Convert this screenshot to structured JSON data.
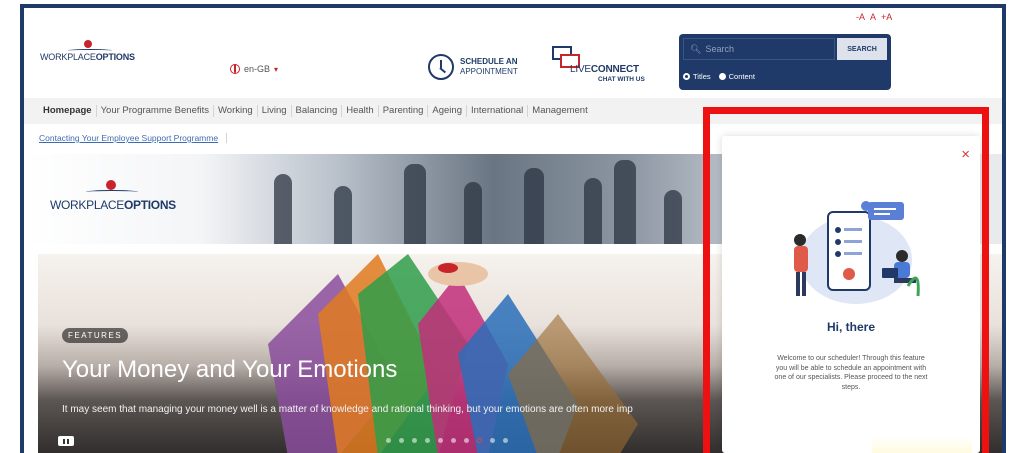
{
  "header": {
    "logo_prefix": "WORKPLACE",
    "logo_suffix": "OPTIONS",
    "language": "en-GB",
    "schedule_line1": "SCHEDULE AN",
    "schedule_line2": "APPOINTMENT",
    "live_prefix": "LIVE",
    "live_suffix": "CONNECT",
    "live_sub": "CHAT WITH US",
    "font_sizes": [
      "-A",
      "A",
      "+A"
    ],
    "search": {
      "placeholder": "Search",
      "button": "SEARCH",
      "option_titles": "Titles",
      "option_content": "Content"
    }
  },
  "nav": {
    "items": [
      "Homepage",
      "Your Programme Benefits",
      "Working",
      "Living",
      "Balancing",
      "Health",
      "Parenting",
      "Ageing",
      "International",
      "Management"
    ]
  },
  "subnav": {
    "link": "Contacting Your Employee Support Programme"
  },
  "banner": {
    "logo_prefix": "WORKPLACE",
    "logo_suffix": "OPTIONS"
  },
  "hero": {
    "tag": "FEATURES",
    "title": "Your Money and Your Emotions",
    "description": "It may seem that managing your money well is a matter of knowledge and rational thinking, but your emotions are often more imp",
    "slide_count": 10,
    "active_slide": 8
  },
  "popup": {
    "close": "×",
    "greeting": "Hi, there",
    "message": "Welcome to our scheduler! Through this feature you will be able to schedule an appointment with one of our specialists. Please proceed to the next steps."
  },
  "colors": {
    "brand_navy": "#1f3a68",
    "brand_red": "#c8242b",
    "highlight_red": "#ee1111"
  }
}
